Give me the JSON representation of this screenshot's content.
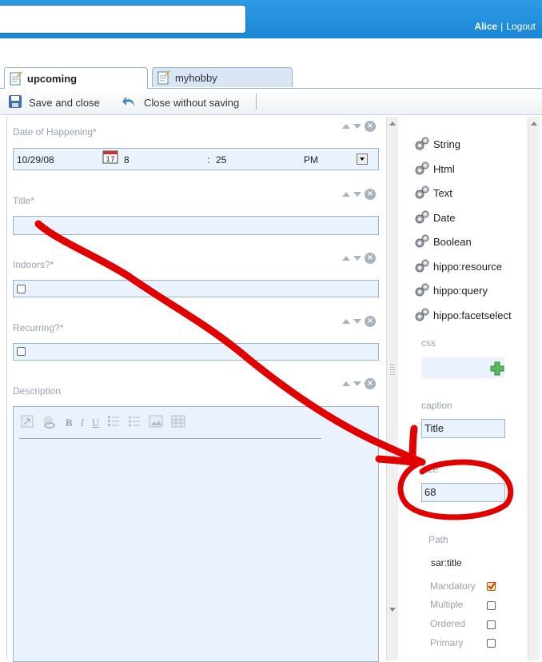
{
  "header": {
    "user": "Alice",
    "separator": "|",
    "logout": "Logout"
  },
  "tabs": [
    {
      "label": "upcoming",
      "active": true
    },
    {
      "label": "myhobby",
      "active": false
    }
  ],
  "toolbar": {
    "save_close": "Save and close",
    "close_nosave": "Close without saving"
  },
  "form": {
    "date_label": "Date of Happening*",
    "date_value": "10/29/08",
    "hour": "8",
    "time_sep": ":",
    "minute": "25",
    "ampm": "PM",
    "calendar_day": "17",
    "title_label": "Title*",
    "indoors_label": "Indoors?*",
    "recurring_label": "Recurring?*",
    "description_label": "Description",
    "rte_bold": "B",
    "rte_italic": "I",
    "rte_underline": "U"
  },
  "palette": {
    "types": [
      "String",
      "Html",
      "Text",
      "Date",
      "Boolean",
      "hippo:resource",
      "hippo:query",
      "hippo:facetselect"
    ]
  },
  "properties": {
    "css_label": "css",
    "caption_label": "caption",
    "caption_value": "Title",
    "size_label": "size",
    "size_value": "68",
    "path_label": "Path",
    "path_value": "sar:title",
    "mandatory_label": "Mandatory",
    "mandatory_checked": true,
    "multiple_label": "Multiple",
    "ordered_label": "Ordered",
    "primary_label": "Primary"
  },
  "colors": {
    "accent": "#1a86d6",
    "annotation": "#e00000",
    "field_bg": "#eaf3fd"
  }
}
